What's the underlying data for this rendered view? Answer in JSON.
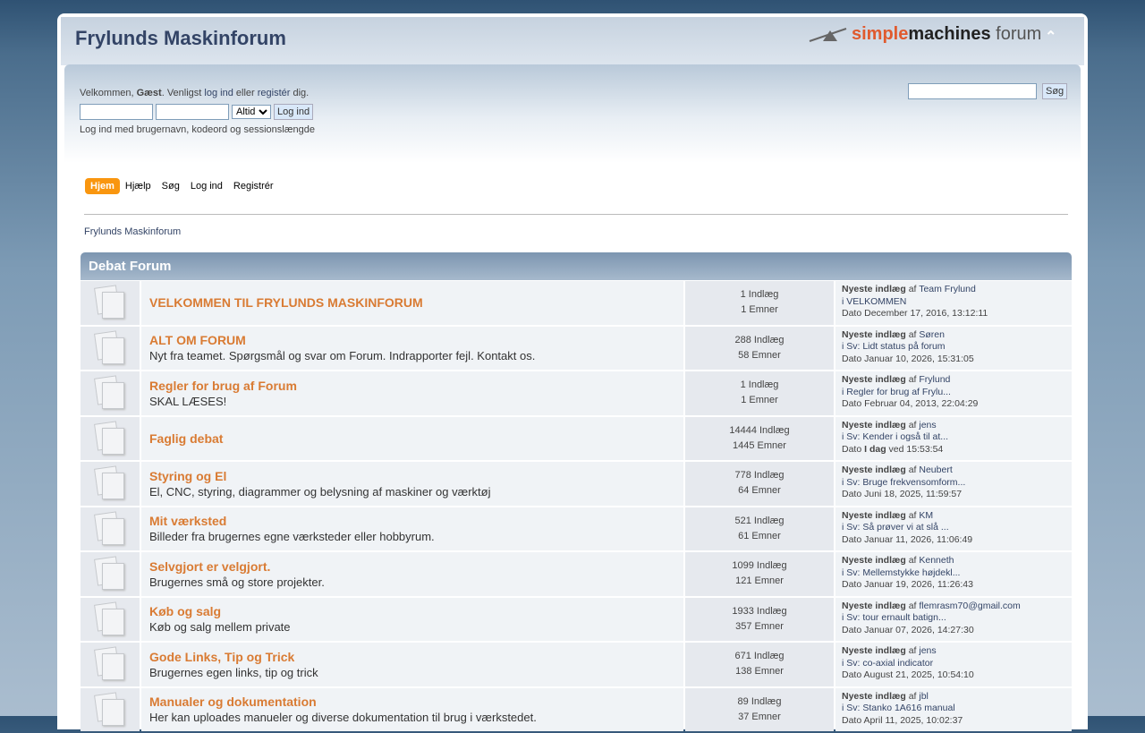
{
  "header": {
    "title": "Frylunds Maskinforum",
    "logo": {
      "simple": "simple",
      "machines": "machines",
      "forum": " forum"
    }
  },
  "user": {
    "welcome": "Velkommen, ",
    "guest": "Gæst",
    "please": ". Venligst ",
    "login": "log ind",
    "or": " eller ",
    "register": "registér",
    "end": " dig.",
    "session_option": "Altid",
    "login_button": "Log ind",
    "hint": "Log ind med brugernavn, kodeord og sessionslængde"
  },
  "search": {
    "button": "Søg",
    "value": ""
  },
  "menu": [
    "Hjem",
    "Hjælp",
    "Søg",
    "Log ind",
    "Registrér"
  ],
  "breadcrumb": "Frylunds Maskinforum",
  "category": "Debat Forum",
  "labels": {
    "newest": "Nyeste indlæg",
    "by": " af ",
    "date": "Dato "
  },
  "boards": [
    {
      "name": "VELKOMMEN TIL FRYLUNDS MASKINFORUM",
      "desc": "",
      "posts": "1 Indlæg",
      "topics": "1 Emner",
      "author": "Team Frylund",
      "topic": "i VELKOMMEN",
      "date": "December 17, 2016, 13:12:11"
    },
    {
      "name": "ALT OM FORUM",
      "desc": "Nyt fra teamet. Spørgsmål og svar om Forum. Indrapporter fejl. Kontakt os.",
      "posts": "288 Indlæg",
      "topics": "58 Emner",
      "author": "Søren",
      "topic": "i Sv: Lidt status på forum",
      "date": "Januar 10, 2026, 15:31:05"
    },
    {
      "name": "Regler for brug af Forum",
      "desc": "SKAL LÆSES!",
      "posts": "1 Indlæg",
      "topics": "1 Emner",
      "author": "Frylund",
      "topic": "i Regler for brug af Frylu...",
      "date": "Februar 04, 2013, 22:04:29"
    },
    {
      "name": "Faglig debat",
      "desc": "",
      "posts": "14444 Indlæg",
      "topics": "1445 Emner",
      "author": "jens",
      "topic": "i Sv: Kender i også til at...",
      "date_bold": "I dag",
      "date": " ved 15:53:54"
    },
    {
      "name": "Styring og El",
      "desc": "El, CNC, styring, diagrammer og belysning af maskiner og værktøj",
      "posts": "778 Indlæg",
      "topics": "64 Emner",
      "author": "Neubert",
      "topic": "i Sv: Bruge frekvensomform...",
      "date": "Juni 18, 2025, 11:59:57"
    },
    {
      "name": "Mit værksted",
      "desc": "Billeder fra brugernes egne værksteder eller hobbyrum.",
      "posts": "521 Indlæg",
      "topics": "61 Emner",
      "author": "KM",
      "topic": "i Sv: Så prøver vi at slå ...",
      "date": "Januar 11, 2026, 11:06:49"
    },
    {
      "name": "Selvgjort er velgjort.",
      "desc": "Brugernes små og store projekter.",
      "posts": "1099 Indlæg",
      "topics": "121 Emner",
      "author": "Kenneth",
      "topic": "i Sv: Mellemstykke højdekl...",
      "date": "Januar 19, 2026, 11:26:43"
    },
    {
      "name": "Køb og salg",
      "desc": "Køb og salg mellem private",
      "posts": "1933 Indlæg",
      "topics": "357 Emner",
      "author": "flemrasm70@gmail.com",
      "topic": "i Sv: tour ernault batign...",
      "date": "Januar 07, 2026, 14:27:30"
    },
    {
      "name": "Gode Links, Tip og Trick",
      "desc": "Brugernes egen links, tip og trick",
      "posts": "671 Indlæg",
      "topics": "138 Emner",
      "author": "jens",
      "topic": "i Sv: co-axial indicator",
      "date": "August 21, 2025, 10:54:10"
    },
    {
      "name": "Manualer og dokumentation",
      "desc": "Her kan uploades manueler og diverse dokumentation til brug i værkstedet.",
      "posts": "89 Indlæg",
      "topics": "37 Emner",
      "author": "jbl",
      "topic": "i Sv: Stanko 1A616 manual",
      "date": "April 11, 2025, 10:02:37"
    }
  ]
}
